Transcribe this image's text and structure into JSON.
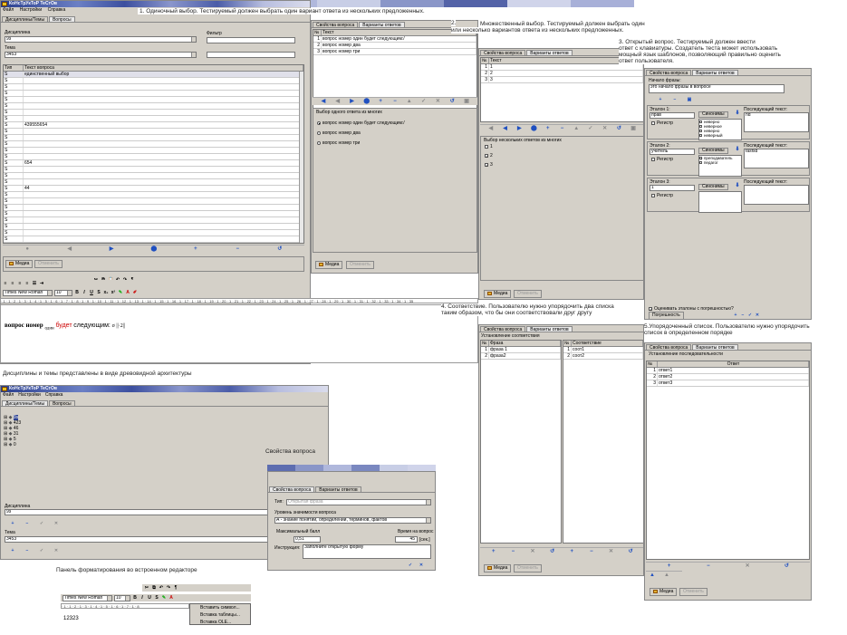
{
  "colors": {
    "title_start": "#2a3f8f",
    "title_end": "#dadcec",
    "window_bg": "#d4d0c8",
    "accent_blue": "#2050c0",
    "red": "#b00000"
  },
  "app": {
    "title": "КоНсТрУкТоР ТеСтОв",
    "menu": [
      "Файл",
      "Настройки",
      "Справка"
    ]
  },
  "captions": {
    "c1": "1.          Одиночный выбор. Тестируемый должен выбрать один вариант ответа из нескольких предложенных.",
    "c2a": "2.",
    "c2b": "Множественный выбор. Тестируемый должен выбрать один",
    "c2c": "или несколько вариантов ответа из нескольких предложенных.",
    "c3a": "3.           Открытый вопрос. Тестируемый должен ввести",
    "c3b": "ответ с клавиатуры. Создатель теста может использовать",
    "c3c": "мощный язык шаблонов, позволяющий правильно оценить",
    "c3d": "ответ пользователя.",
    "c4a": "4.                    Соответствие. Пользователю нужно упорядочить два списка",
    "c4b": "таким образом, что бы они соответствовали друг другу",
    "c5a": "5.Упорядоченный список. Пользователю нужно упорядочить",
    "c5b": "список в определенном порядке",
    "tree": "Дисциплины и темы представлены в виде древовидной архитектуры",
    "props": "Свойства вопроса",
    "fmt": "Панель форматирования во встроенном редакторе"
  },
  "main": {
    "tabs": [
      "Дисциплины/Темы",
      "Вопросы"
    ],
    "discipline_label": "Дисциплина",
    "discipline_value": "9з",
    "filter_label": "Фильтр",
    "topic_label": "Тема",
    "topic_value": "3453",
    "grid_headers": [
      "Тип",
      "Текст вопроса"
    ],
    "rows": [
      "единственный выбор",
      "",
      "",
      "",
      "",
      "",
      "",
      "",
      "439555654",
      "",
      "",
      "",
      "",
      "",
      "654",
      "",
      "",
      "",
      "44",
      "",
      "",
      "",
      "",
      "",
      "",
      "",
      "",
      "gf",
      ""
    ],
    "row_type": "S",
    "media_label": "Медиа",
    "cancel_label": "Отменить"
  },
  "single": {
    "tabs": [
      "Свойства вопроса",
      "Варианты ответов"
    ],
    "headers": [
      "№",
      "Текст"
    ],
    "rows": [
      [
        "1",
        "вопрос номер один будет следующим:/"
      ],
      [
        "2",
        "вопрос номер два"
      ],
      [
        "3",
        "вопрос номер три"
      ]
    ],
    "group_title": "Выбор одного ответа из многих",
    "options": [
      "вопрос номер один будет следующим:/",
      "вопрос номер два",
      "вопрос номер три"
    ],
    "media_label": "Медиа",
    "cancel_label": "Отменить"
  },
  "multi": {
    "tabs": [
      "Свойства вопроса",
      "Варианты ответов"
    ],
    "headers": [
      "№",
      "Текст"
    ],
    "rows": [
      [
        "1",
        "1"
      ],
      [
        "2",
        "2"
      ],
      [
        "3",
        "3"
      ]
    ],
    "group_title": "Выбор нескольких ответов из многих",
    "options": [
      "1",
      "2",
      "3"
    ],
    "media_label": "Медиа",
    "cancel_label": "Отменить"
  },
  "open": {
    "tabs": [
      "Свойства вопроса",
      "Варианты ответов"
    ],
    "start_label": "Начало фразы:",
    "start_value": "это начало фразы в вопросе",
    "standards": [
      {
        "title": "Эталон 1:",
        "value": "прав",
        "reg": "Регистр",
        "syn": "Синонимы",
        "syn_list": [
          "неверно",
          "неверное",
          "неверно",
          "неверный"
        ],
        "next": "Последующий текст:",
        "next_val": "hd"
      },
      {
        "title": "Эталон 2:",
        "value": "учитель",
        "reg": "Регистр",
        "syn": "Синонимы",
        "syn_list": [
          "преподаватель",
          "педагог"
        ],
        "next": "Последующий текст:",
        "next_val": "fasfsd"
      },
      {
        "title": "Эталон 3:",
        "value": "1",
        "reg": "Регистр",
        "syn": "Синонимы",
        "syn_list": [],
        "next": "Последующий текст:",
        "next_val": ""
      }
    ],
    "estimate": "Оценивать эталоны с погрешностью?",
    "error_label": "Погрешность"
  },
  "match": {
    "tabs": [
      "Свойства вопроса",
      "Варианты ответов"
    ],
    "group_title": "Установление соответствия",
    "left_headers": [
      "№",
      "Фраза"
    ],
    "left_rows": [
      [
        "1",
        "фраза 1"
      ],
      [
        "2",
        "фраза2"
      ]
    ],
    "right_headers": [
      "№",
      "Соответствие"
    ],
    "right_rows": [
      [
        "1",
        "соот1"
      ],
      [
        "2",
        "соот2"
      ]
    ],
    "media_label": "Медиа",
    "cancel_label": "Отменить"
  },
  "ordered": {
    "tabs": [
      "Свойства вопроса",
      "Варианты ответов"
    ],
    "group_title": "Установление последовательности",
    "headers": [
      "№",
      "Ответ"
    ],
    "rows": [
      [
        "1",
        "ответ1"
      ],
      [
        "2",
        "ответ2"
      ],
      [
        "3",
        "ответ3"
      ]
    ],
    "media_label": "Медиа",
    "cancel_label": "Отменить"
  },
  "editor": {
    "font": "Times New Roman",
    "size": "10",
    "text_bold": "вопрос номер",
    "text_sub": "один",
    "text_red": "будет",
    "text_rest": "следующим:",
    "ruler": "· 1 · 1 · 2 · 1 · 3 · 1 · 4 · 1 · 5 · 1 · 6 · 1 · 7 · 1 · 8 · 1 · 9 · 1 · 10 · 1 · 11 · 1 · 12 · 1 · 13 · 1 · 14 · 1 · 15 · 1 · 16 · 1 · 17 · 1 · 18 · 1 · 19 · 1 · 20 · 1 · 21 · 1 · 22 · 1 · 23 · 1 · 24 · 1 · 25 · 1 · 26 · 1 · 27 · 1 · 28 · 1 · 29 · 1 · 30 · 1 · 31 · 1 · 32 · 1 · 33 · 1 · 34 · 1 · 35"
  },
  "tree": {
    "title": "КоНсТрУкТоР ТеСтОв",
    "menu": [
      "Файл",
      "Настройки",
      "Справка"
    ],
    "tabs": [
      "Дисциплины/Темы",
      "Вопросы"
    ],
    "items": [
      "9з",
      "423",
      "46",
      "31",
      "5",
      "0"
    ],
    "discipline_label": "Дисциплина",
    "discipline_value": "9з",
    "topic_label": "Тема",
    "topic_value": "3453"
  },
  "props": {
    "tabs": [
      "Свойства вопроса",
      "Варианты ответов"
    ],
    "type_label": "Тип:",
    "type_value": "Открытая фраза",
    "level_label": "Уровень значимости вопроса",
    "level_value": "А - знание понятий, определений, терминов, фактов",
    "maxscore_label": "Максимальный балл",
    "maxscore_value": "0,51",
    "time_label": "Время на вопрос",
    "time_value": "45",
    "time_unit": "[сек.]",
    "instr_label": "Инструкция:",
    "instr_value": "Заполните открытую форму"
  },
  "fmt": {
    "font": "Times New Roman",
    "size": "10",
    "ruler": "· 1 · 1 · 2 · 1 · 3 · 1 · 4 · 1 · 5 · 1 · 6 · 1 · 7 · 1 · 8",
    "text": "12323",
    "menu": [
      "Вставить символ...",
      "Вставка таблицы...",
      "Вставка OLE..."
    ]
  }
}
